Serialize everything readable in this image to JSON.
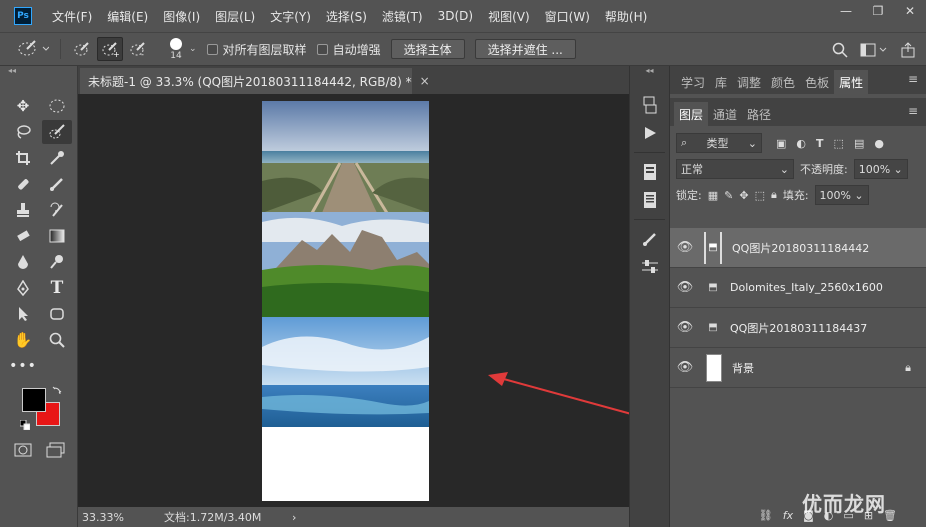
{
  "app": {
    "logo": "Ps"
  },
  "menu": [
    "文件(F)",
    "编辑(E)",
    "图像(I)",
    "图层(L)",
    "文字(Y)",
    "选择(S)",
    "滤镜(T)",
    "3D(D)",
    "视图(V)",
    "窗口(W)",
    "帮助(H)"
  ],
  "window_controls": {
    "minimize": "—",
    "restore": "❐",
    "close": "✕"
  },
  "options": {
    "brush_size": "14",
    "sample_all_layers": "对所有图层取样",
    "auto_enhance": "自动增强",
    "select_subject": "选择主体",
    "select_and_mask": "选择并遮住 ..."
  },
  "toolbar_collapse": "◂◂",
  "document": {
    "tab_title": "未标题-1 @ 33.3% (QQ图片20180311184442, RGB/8) *",
    "tab_close": "×"
  },
  "status": {
    "zoom": "33.33%",
    "doc_info": "文档:1.72M/3.40M",
    "arrow": "›"
  },
  "panels": {
    "top_tabs": [
      "学习",
      "库",
      "调整",
      "颜色",
      "色板",
      "属性"
    ],
    "active_top_tab": "属性",
    "layer_tabs": [
      "图层",
      "通道",
      "路径"
    ],
    "active_layer_tab": "图层",
    "filter_kind": "类型",
    "blend_mode": "正常",
    "opacity_label": "不透明度:",
    "opacity_value": "100%",
    "lock_label": "锁定:",
    "fill_label": "填充:",
    "fill_value": "100%",
    "menu_icon": "≡"
  },
  "layers": [
    {
      "name": "QQ图片20180311184442",
      "selected": true
    },
    {
      "name": "Dolomites_Italy_2560x1600",
      "selected": false
    },
    {
      "name": "QQ图片20180311184437",
      "selected": false
    },
    {
      "name": "背景",
      "selected": false,
      "locked": true
    }
  ],
  "watermark": "优而龙网",
  "colors": {
    "foreground": "#000000",
    "background": "#e81616",
    "accent_arrow": "#e03a3a"
  }
}
